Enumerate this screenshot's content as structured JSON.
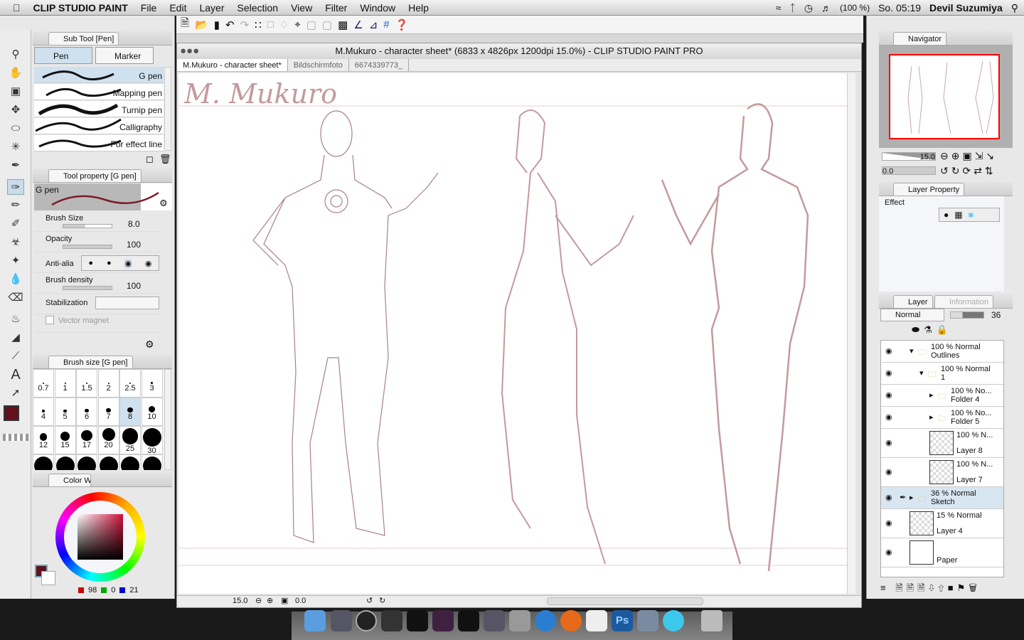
{
  "menubar": {
    "app": "CLIP STUDIO PAINT",
    "items": [
      "File",
      "Edit",
      "Layer",
      "Selection",
      "View",
      "Filter",
      "Window",
      "Help"
    ],
    "battery": "(100 %)",
    "clock": "So. 05:19",
    "user": "Devil Suzumiya"
  },
  "subtool": {
    "title": "Sub Tool [Pen]",
    "groups": [
      "Pen",
      "Marker"
    ],
    "brushes": [
      "G pen",
      "Mapping pen",
      "Turnip pen",
      "Calligraphy",
      "For effect line"
    ],
    "selected": "G pen"
  },
  "toolprop": {
    "title": "Tool property [G pen]",
    "preview_name": "G pen",
    "brush_size_label": "Brush Size",
    "brush_size": "8.0",
    "opacity_label": "Opacity",
    "opacity": "100",
    "antialias_label": "Anti-alia",
    "density_label": "Brush density",
    "density": "100",
    "stabilization_label": "Stabilization",
    "vector_magnet_label": "Vector magnet"
  },
  "brushsize": {
    "title": "Brush size [G pen]",
    "sizes": [
      "0.7",
      "1",
      "1.5",
      "2",
      "2.5",
      "3",
      "4",
      "5",
      "6",
      "7",
      "8",
      "10",
      "12",
      "15",
      "17",
      "20",
      "25",
      "30"
    ],
    "selected": "8"
  },
  "color": {
    "tab": "Color W",
    "main_color": "#62101c",
    "r": "98",
    "g": "0",
    "b": "21"
  },
  "document": {
    "window_title": "M.Mukuro - character sheet* (6833 x 4826px 1200dpi 15.0%)  - CLIP STUDIO PAINT PRO",
    "tabs": [
      "M.Mukuro - character sheet*",
      "Bildschirmfoto",
      "6674339773_"
    ],
    "canvas_title": "M. Mukuro",
    "zoom": "15.0",
    "rotation": "0.0",
    "sketch_color": "#c49a9c"
  },
  "navigator": {
    "title": "Navigator",
    "zoom": "15.0",
    "rotation": "0.0"
  },
  "layerprop": {
    "title": "Layer Property",
    "effect_label": "Effect"
  },
  "layers": {
    "tabs": [
      "Layer",
      "Information"
    ],
    "blend_mode": "Normal",
    "opacity": "36",
    "items": [
      {
        "mode": "100 % Normal",
        "name": "Outlines",
        "type": "folder",
        "open": true
      },
      {
        "mode": "100 % Normal",
        "name": "1",
        "type": "folder",
        "open": true
      },
      {
        "mode": "100 % No...",
        "name": "Folder 4",
        "type": "folder",
        "open": false
      },
      {
        "mode": "100 % No...",
        "name": "Folder 5",
        "type": "folder",
        "open": false
      },
      {
        "mode": "100 % N...",
        "name": "Layer 8",
        "type": "raster"
      },
      {
        "mode": "100 % N...",
        "name": "Layer 7",
        "type": "raster"
      },
      {
        "mode": "36 % Normal",
        "name": "Sketch",
        "type": "folder",
        "open": false,
        "selected": true
      },
      {
        "mode": "15 % Normal",
        "name": "Layer 4",
        "type": "raster"
      },
      {
        "mode": "",
        "name": "Paper",
        "type": "paper"
      }
    ]
  }
}
